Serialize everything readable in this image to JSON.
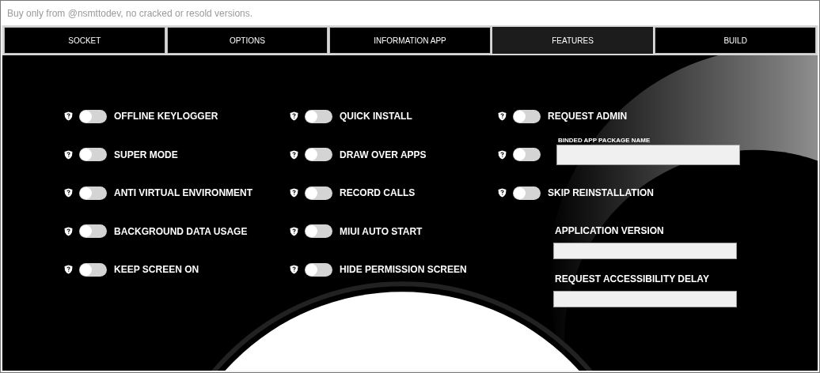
{
  "window": {
    "title": "Buy only from @nsmttodev, no cracked or resold versions."
  },
  "tabs": [
    {
      "label": "SOCKET",
      "selected": false
    },
    {
      "label": "OPTIONS",
      "selected": false
    },
    {
      "label": "INFORMATION APP",
      "selected": false
    },
    {
      "label": "FEATURES",
      "selected": true
    },
    {
      "label": "BUILD",
      "selected": false
    }
  ],
  "columns": [
    {
      "items": [
        {
          "kind": "toggle",
          "label": "OFFLINE KEYLOGGER",
          "on": false
        },
        {
          "kind": "toggle",
          "label": "SUPER MODE",
          "on": false
        },
        {
          "kind": "toggle",
          "label": "ANTI VIRTUAL ENVIRONMENT",
          "on": false
        },
        {
          "kind": "toggle",
          "label": "BACKGROUND DATA USAGE",
          "on": false
        },
        {
          "kind": "toggle",
          "label": "KEEP SCREEN ON",
          "on": false
        }
      ]
    },
    {
      "items": [
        {
          "kind": "toggle",
          "label": "QUICK INSTALL",
          "on": false
        },
        {
          "kind": "toggle",
          "label": "DRAW OVER APPS",
          "on": false
        },
        {
          "kind": "toggle",
          "label": "RECORD CALLS",
          "on": false
        },
        {
          "kind": "toggle",
          "label": "MIUI AUTO START",
          "on": false
        },
        {
          "kind": "toggle",
          "label": "HIDE PERMISSION SCREEN",
          "on": false
        }
      ]
    },
    {
      "items": [
        {
          "kind": "toggle",
          "label": "REQUEST ADMIN",
          "on": false
        },
        {
          "kind": "toggle_field",
          "field_label": "BINDED APP PACKAGE NAME",
          "on": false
        },
        {
          "kind": "toggle",
          "label": "SKIP REINSTALLATION",
          "on": false
        },
        {
          "kind": "field",
          "label": "APPLICATION VERSION"
        },
        {
          "kind": "field",
          "label": "REQUEST ACCESSIBILITY DELAY"
        }
      ]
    }
  ]
}
